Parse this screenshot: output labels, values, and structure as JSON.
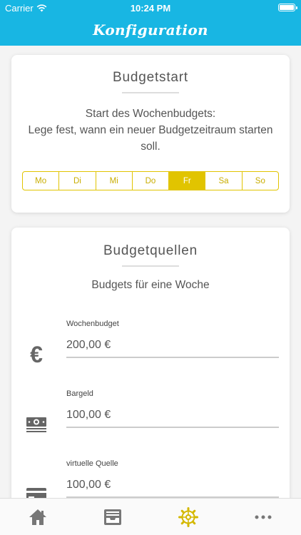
{
  "status_bar": {
    "carrier": "Carrier",
    "time": "10:24 PM"
  },
  "header": {
    "title": "Konfiguration",
    "bg_color": "#18b6e3"
  },
  "budget_start": {
    "title": "Budgetstart",
    "description_line1": "Start des Wochenbudgets:",
    "description_line2": "Lege fest, wann ein neuer Budgetzeitraum starten soll.",
    "weekdays": [
      "Mo",
      "Di",
      "Mi",
      "Do",
      "Fr",
      "Sa",
      "So"
    ],
    "selected_day": "Fr",
    "accent_color": "#e1c400"
  },
  "budget_sources": {
    "title": "Budgetquellen",
    "subtitle": "Budgets für eine Woche",
    "fields": [
      {
        "label": "Wochenbudget",
        "value": "200,00 €",
        "icon": "euro-icon"
      },
      {
        "label": "Bargeld",
        "value": "100,00 €",
        "icon": "cash-icon"
      },
      {
        "label": "virtuelle Quelle",
        "value": "100,00 €",
        "icon": "credit-card-icon"
      }
    ]
  },
  "tab_bar": {
    "tabs": [
      {
        "icon": "home-icon",
        "active": false
      },
      {
        "icon": "inbox-icon",
        "active": false
      },
      {
        "icon": "settings-gear-icon",
        "active": true
      },
      {
        "icon": "more-icon",
        "active": false
      }
    ],
    "active_color": "#e1c400"
  }
}
